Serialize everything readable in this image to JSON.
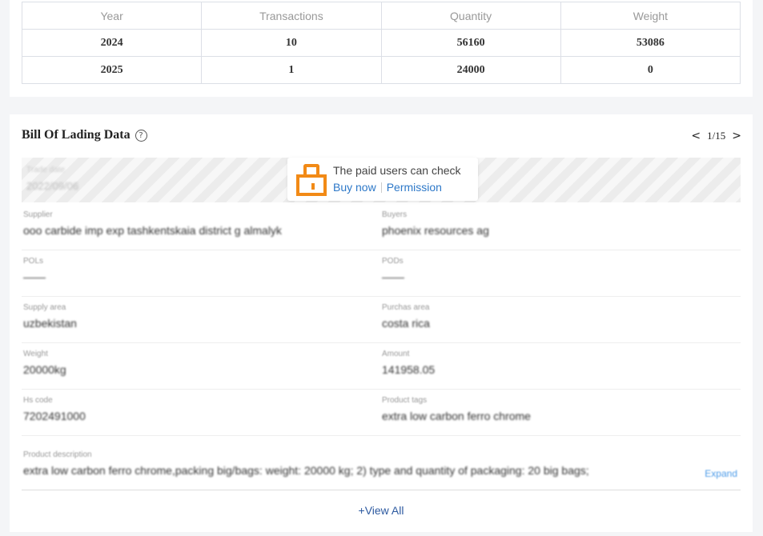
{
  "yearly_table": {
    "headers": [
      "Year",
      "Transactions",
      "Quantity",
      "Weight"
    ],
    "rows": [
      [
        "2024",
        "10",
        "56160",
        "53086"
      ],
      [
        "2025",
        "1",
        "24000",
        "0"
      ]
    ]
  },
  "bill_of_lading": {
    "title": "Bill Of Lading Data",
    "help_glyph": "?",
    "pager": {
      "prev": "<",
      "page": "1/15",
      "next": ">"
    },
    "trade_date": {
      "label": "Trade date",
      "value": "2022/09/06"
    },
    "paywall": {
      "message": "The paid users can check",
      "buy_now": "Buy now",
      "permission": "Permission"
    },
    "fields": {
      "supplier": {
        "label": "Supplier",
        "value": "ooo carbide imp exp tashkentskaia district g almalyk"
      },
      "buyers": {
        "label": "Buyers",
        "value": "phoenix resources ag"
      },
      "pols": {
        "label": "POLs",
        "value": "——"
      },
      "pods": {
        "label": "PODs",
        "value": "——"
      },
      "supply_area": {
        "label": "Supply area",
        "value": "uzbekistan"
      },
      "purchase_area": {
        "label": "Purchas area",
        "value": "costa rica"
      },
      "weight": {
        "label": "Weight",
        "value": "20000kg"
      },
      "amount": {
        "label": "Amount",
        "value": "141958.05"
      },
      "hs_code": {
        "label": "Hs code",
        "value": "7202491000"
      },
      "product_tags": {
        "label": "Product tags",
        "value": "extra low carbon ferro chrome"
      },
      "product_description": {
        "label": "Product description",
        "value": "extra low carbon ferro chrome,packing big/bags: weight: 20000 kg; 2) type and quantity of packaging: 20 big bags;"
      }
    },
    "expand_label": "Expand",
    "view_all_label": "+View All"
  }
}
